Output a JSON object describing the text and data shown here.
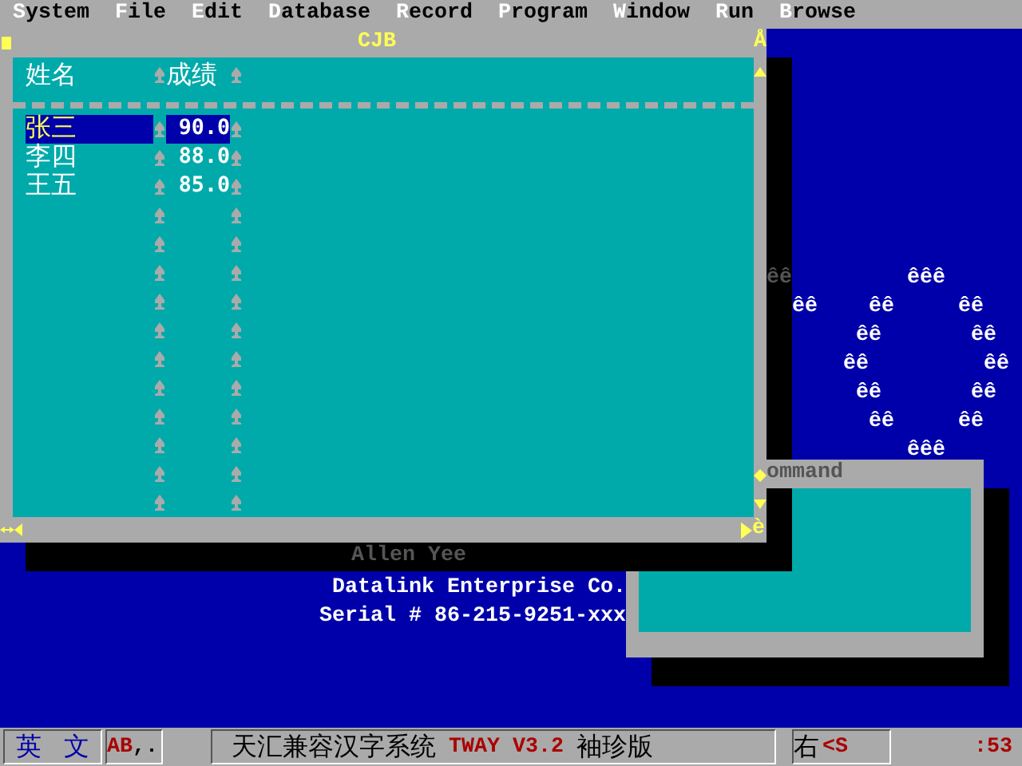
{
  "menu_bar": [
    {
      "label": "System"
    },
    {
      "label": "File"
    },
    {
      "label": "Edit"
    },
    {
      "label": "Database"
    },
    {
      "label": "Record"
    },
    {
      "label": "Program"
    },
    {
      "label": "Window"
    },
    {
      "label": "Run"
    },
    {
      "label": "Browse"
    }
  ],
  "browse_window": {
    "title": "CJB",
    "corner_glyph_top": "Å",
    "corner_glyph_bottom": "è",
    "columns": [
      {
        "label": "姓名"
      },
      {
        "label": "成绩"
      }
    ],
    "rows": [
      {
        "name": "张三",
        "score": "90.0",
        "selected": true
      },
      {
        "name": "李四",
        "score": "88.0",
        "selected": false
      },
      {
        "name": "王五",
        "score": "85.0",
        "selected": false
      }
    ],
    "shadow_text": "Allen Yee"
  },
  "command_window": {
    "title": "ommand"
  },
  "logo_lines": [
    [
      {
        "text": "êê",
        "dim": true
      },
      {
        "text": "         êêê",
        "dim": false
      }
    ],
    [
      {
        "text": "  êê    êê     êê",
        "dim": false
      }
    ],
    [
      {
        "text": "       êê       êê",
        "dim": false
      }
    ],
    [
      {
        "text": "      êê         êê",
        "dim": false
      }
    ],
    [
      {
        "text": "       êê       êê",
        "dim": false
      }
    ],
    [
      {
        "text": "        êê     êê",
        "dim": false
      }
    ],
    [
      {
        "text": "           êêê",
        "dim": false
      }
    ]
  ],
  "credits": [
    "Datalink Enterprise Co.",
    "Serial # 86-215-9251-xxx"
  ],
  "status_bar": {
    "input_mode": [
      "英",
      "文"
    ],
    "case_mode": "AB",
    "punct_mode": ",.",
    "system_name": "天汇兼容汉字系统",
    "version": "TWAY V3.2",
    "edition": "袖珍版",
    "position": "右",
    "position_code": "<S",
    "clock": ":53"
  }
}
